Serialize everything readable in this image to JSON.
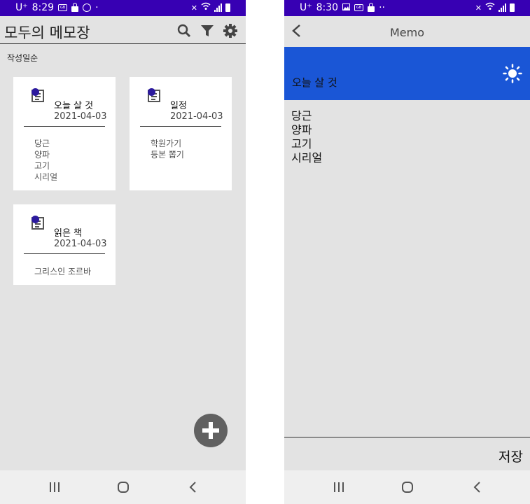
{
  "left_screen": {
    "status_bar": {
      "carrier": "U⁺",
      "time": "8:29",
      "dot": "·"
    },
    "app_title": "모두의 메모장",
    "toolbar_icons": [
      "search-icon",
      "filter-icon",
      "gear-icon"
    ],
    "sort_label": "작성일순",
    "memos": [
      {
        "title": "오늘 살 것",
        "date": "2021-04-03",
        "lines": [
          "당근",
          "양파",
          "고기",
          "시리얼"
        ]
      },
      {
        "title": "일정",
        "date": "2021-04-03",
        "lines": [
          "학원가기",
          "등본 뽑기"
        ]
      },
      {
        "title": "읽은 책",
        "date": "2021-04-03",
        "lines": [
          "그리스인 조르바"
        ]
      }
    ],
    "fab_icon": "plus-icon",
    "nav_icons": [
      "recent-apps-icon",
      "home-icon",
      "back-icon"
    ]
  },
  "right_screen": {
    "status_bar": {
      "carrier": "U⁺",
      "time": "8:30",
      "dots": "··"
    },
    "title": "Memo",
    "memo_title": "오늘 살 것",
    "memo_body": [
      "당근",
      "양파",
      "고기",
      "시리얼"
    ],
    "save_label": "저장",
    "header_color": "#1a56d6",
    "nav_icons": [
      "recent-apps-icon",
      "home-icon",
      "back-icon"
    ]
  },
  "colors": {
    "status_bar": "#3700b3",
    "card_dot": "#2c1a9e",
    "fab": "#616161",
    "background": "#e3e3e3"
  }
}
